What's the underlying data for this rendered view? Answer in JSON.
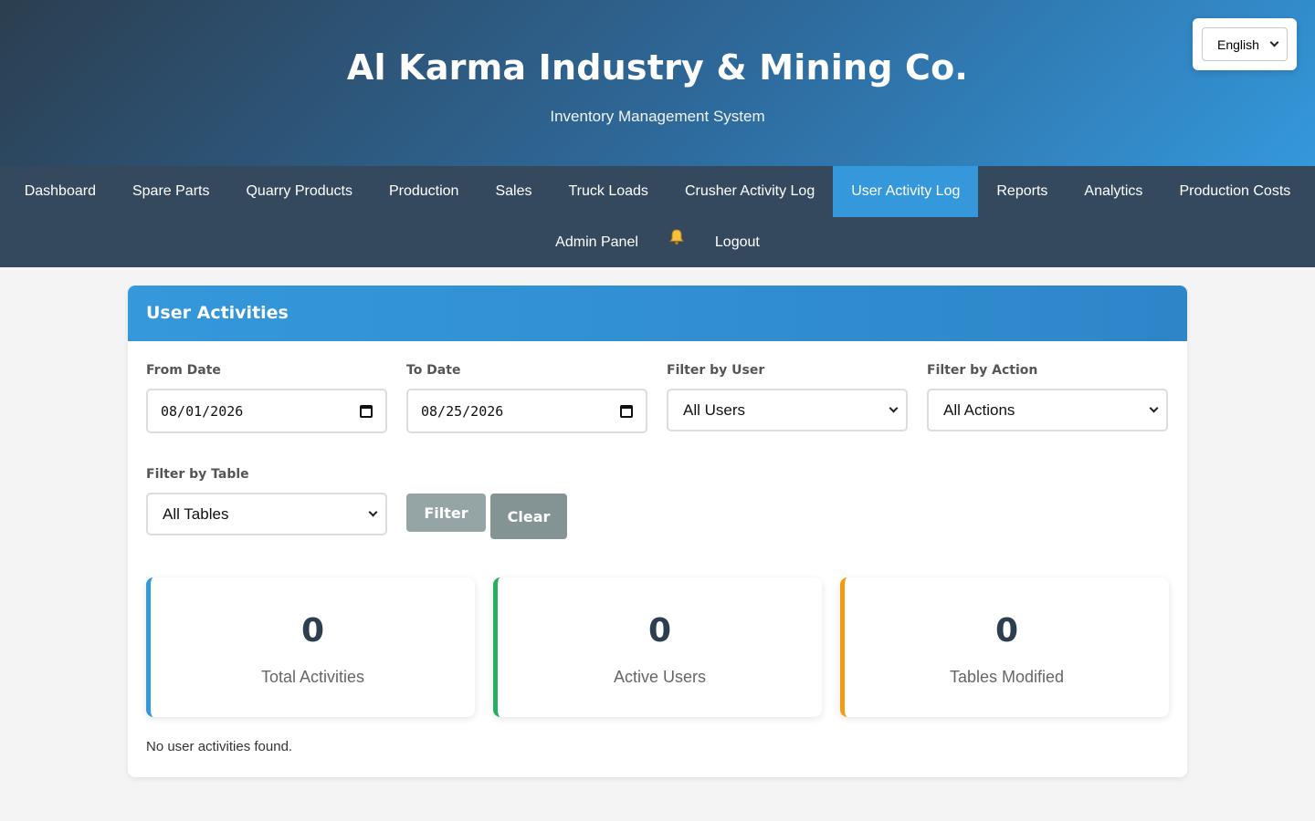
{
  "header": {
    "company": "Al Karma Industry & Mining Co.",
    "subtitle": "Inventory Management System",
    "language": "English"
  },
  "nav": {
    "items": [
      {
        "label": "Dashboard",
        "active": false
      },
      {
        "label": "Spare Parts",
        "active": false
      },
      {
        "label": "Quarry Products",
        "active": false
      },
      {
        "label": "Production",
        "active": false
      },
      {
        "label": "Sales",
        "active": false
      },
      {
        "label": "Truck Loads",
        "active": false
      },
      {
        "label": "Crusher Activity Log",
        "active": false
      },
      {
        "label": "User Activity Log",
        "active": true
      },
      {
        "label": "Reports",
        "active": false
      },
      {
        "label": "Analytics",
        "active": false
      },
      {
        "label": "Production Costs",
        "active": false
      }
    ],
    "admin": "Admin Panel",
    "notification_icon": "bell-icon",
    "logout": "Logout"
  },
  "panel": {
    "title": "User Activities",
    "filters": {
      "from_label": "From Date",
      "from_value": "08/01/2026",
      "to_label": "To Date",
      "to_value": "08/25/2026",
      "user_label": "Filter by User",
      "user_value": "All Users",
      "action_label": "Filter by Action",
      "action_value": "All Actions",
      "table_label": "Filter by Table",
      "table_value": "All Tables",
      "filter_button": "Filter",
      "clear_button": "Clear"
    },
    "stats": [
      {
        "value": "0",
        "label": "Total Activities",
        "color": "#3498db"
      },
      {
        "value": "0",
        "label": "Active Users",
        "color": "#27ae60"
      },
      {
        "value": "0",
        "label": "Tables Modified",
        "color": "#f39c12"
      }
    ],
    "empty_message": "No user activities found."
  },
  "colors": {
    "nav_bg": "#34495e",
    "accent": "#3498db",
    "button_gray": "#95a5a6"
  }
}
